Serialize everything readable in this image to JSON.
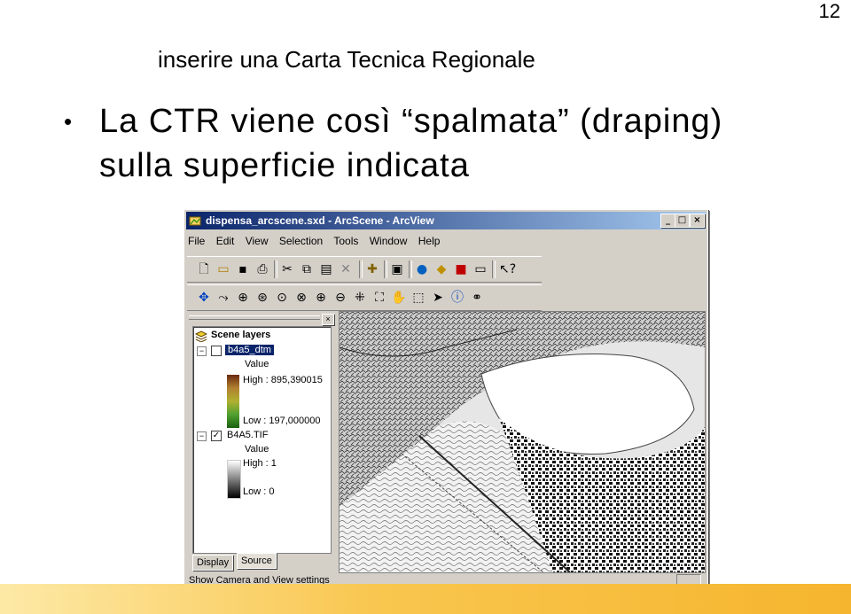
{
  "slide": {
    "number": "12",
    "subtitle": "inserire una Carta Tecnica Regionale",
    "bullet": "La CTR viene così “spalmata” (draping) sulla superficie indicata"
  },
  "window": {
    "title": "dispensa_arcscene.sxd - ArcScene - ArcView",
    "minimize": "_",
    "maximize": "□",
    "close": "×",
    "menu": [
      "File",
      "Edit",
      "View",
      "Selection",
      "Tools",
      "Window",
      "Help"
    ]
  },
  "toolbar1_icons": [
    "new-icon",
    "open-icon",
    "save-icon",
    "print-icon",
    "cut-icon",
    "copy-icon",
    "paste-icon",
    "delete-icon",
    "add-data-icon",
    "scene-properties-icon",
    "globe-icon",
    "arccatalog-icon",
    "toolbox-icon",
    "command-line-icon",
    "whats-this-icon"
  ],
  "toolbar2_icons": [
    "navigate-icon",
    "fly-icon",
    "target-center-icon",
    "zoom-to-target-icon",
    "set-observer-icon",
    "center-on-target-icon",
    "zoom-in-icon",
    "zoom-out-icon",
    "zoom-in-fixed-icon",
    "full-extent-icon",
    "pan-icon",
    "select-features-icon",
    "select-element-icon",
    "identify-icon",
    "find-icon"
  ],
  "toc": {
    "root": "Scene layers",
    "layers": [
      {
        "name": "b4a5_dtm",
        "checked": false,
        "value_label": "Value",
        "high": "High : 895,390015",
        "low": "Low : 197,000000"
      },
      {
        "name": "B4A5.TIF",
        "checked": true,
        "value_label": "Value",
        "high": "High : 1",
        "low": "Low : 0"
      }
    ],
    "tabs": [
      "Display",
      "Source"
    ]
  },
  "status": "Show Camera and View settings",
  "colors": {
    "title_start": "#0a246a",
    "title_end": "#a6caf0",
    "selection": "#0a246a",
    "band_start": "#fde9a6",
    "band_end": "#f6b52e"
  }
}
